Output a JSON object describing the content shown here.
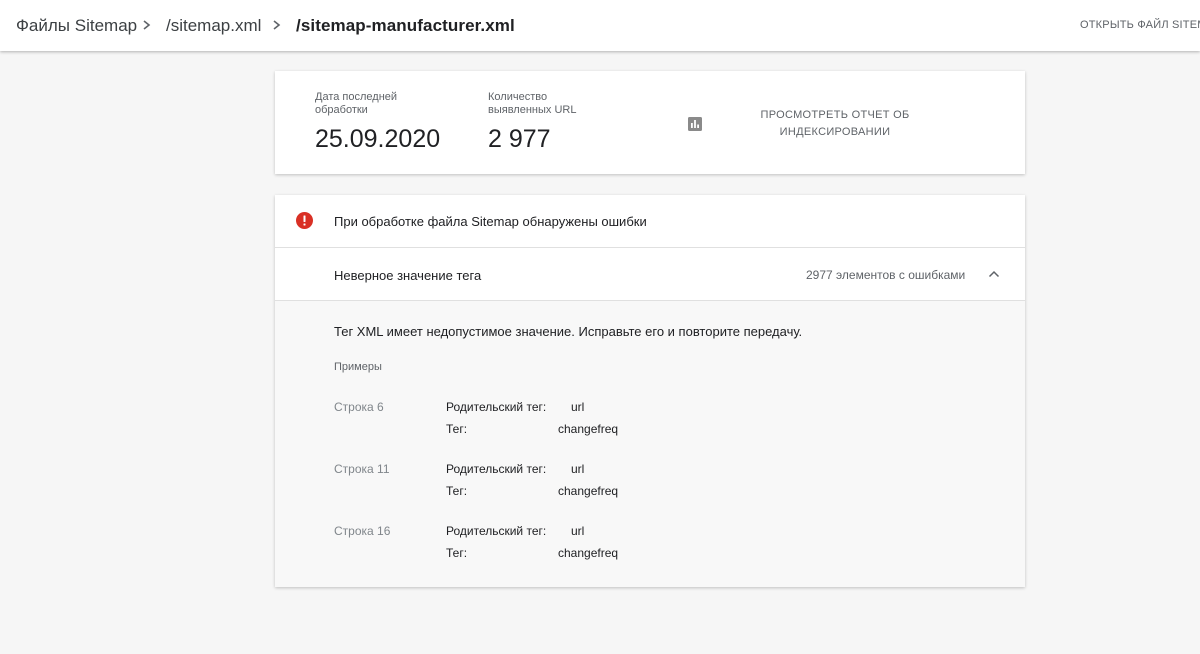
{
  "breadcrumbs": {
    "root": "Файлы Sitemap",
    "parent": "/sitemap.xml",
    "current": "/sitemap-manufacturer.xml"
  },
  "header": {
    "open_sitemap": "ОТКРЫТЬ ФАЙЛ SITEM"
  },
  "stats": {
    "last_processed_label": "Дата последней обработки",
    "last_processed_value": "25.09.2020",
    "discovered_urls_label": "Количество выявленных URL",
    "discovered_urls_value": "2 977",
    "report_link": "ПРОСМОТРЕТЬ ОТЧЕТ ОБ ИНДЕКСИРОВАНИИ"
  },
  "errors": {
    "title": "При обработке файла Sitemap обнаружены ошибки",
    "status_color": "#d93025",
    "issue": {
      "name": "Неверное значение тега",
      "count": "2977 элементов с ошибками"
    },
    "description": "Тег XML имеет недопустимое значение. Исправьте его и повторите передачу.",
    "examples_label": "Примеры",
    "examples": [
      {
        "line": "Строка 6",
        "parent_tag_label": "Родительский тег:",
        "parent_tag_value": "url",
        "tag_label": "Тег:",
        "tag_value": "changefreq"
      },
      {
        "line": "Строка 11",
        "parent_tag_label": "Родительский тег:",
        "parent_tag_value": "url",
        "tag_label": "Тег:",
        "tag_value": "changefreq"
      },
      {
        "line": "Строка 16",
        "parent_tag_label": "Родительский тег:",
        "parent_tag_value": "url",
        "tag_label": "Тег:",
        "tag_value": "changefreq"
      }
    ]
  }
}
